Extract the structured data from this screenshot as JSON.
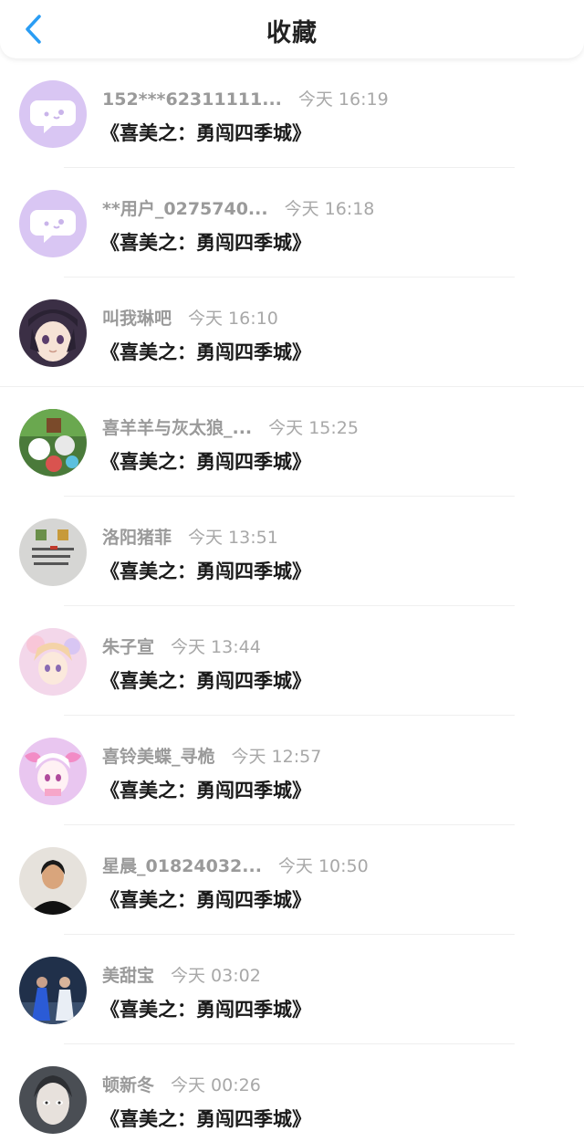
{
  "header": {
    "title": "收藏"
  },
  "rows": [
    {
      "user": "152***62311111...",
      "time": "今天 16:19",
      "work": "《喜美之：勇闯四季城》",
      "avatar": "bubble-icon"
    },
    {
      "user": "**用户_0275740...",
      "time": "今天 16:18",
      "work": "《喜美之：勇闯四季城》",
      "avatar": "bubble-icon"
    },
    {
      "user": "叫我琳吧",
      "time": "今天 16:10",
      "work": "《喜美之：勇闯四季城》",
      "avatar": "anime-girl-avatar"
    },
    {
      "user": "喜羊羊与灰太狼_...",
      "time": "今天 15:25",
      "work": "《喜美之：勇闯四季城》",
      "avatar": "cartoon-group-avatar"
    },
    {
      "user": "洛阳猪菲",
      "time": "今天 13:51",
      "work": "《喜美之：勇闯四季城》",
      "avatar": "note-photo-avatar"
    },
    {
      "user": "朱子宣",
      "time": "今天 13:44",
      "work": "《喜美之：勇闯四季城》",
      "avatar": "pastel-anime-avatar"
    },
    {
      "user": "喜铃美蝶_寻桅",
      "time": "今天 12:57",
      "work": "《喜美之：勇闯四季城》",
      "avatar": "pink-anime-avatar"
    },
    {
      "user": "星晨_01824032...",
      "time": "今天 10:50",
      "work": "《喜美之：勇闯四季城》",
      "avatar": "person-photo-avatar"
    },
    {
      "user": "美甜宝",
      "time": "今天 03:02",
      "work": "《喜美之：勇闯四季城》",
      "avatar": "blue-scene-avatar"
    },
    {
      "user": "顿新冬",
      "time": "今天 00:26",
      "work": "《喜美之：勇闯四季城》",
      "avatar": "face-portrait-avatar"
    }
  ],
  "colors": {
    "accent": "#2a9df4",
    "bubble_bg": "#d9c6f3",
    "name_text": "#9a9a9a",
    "work_text": "#1a1a1a"
  }
}
